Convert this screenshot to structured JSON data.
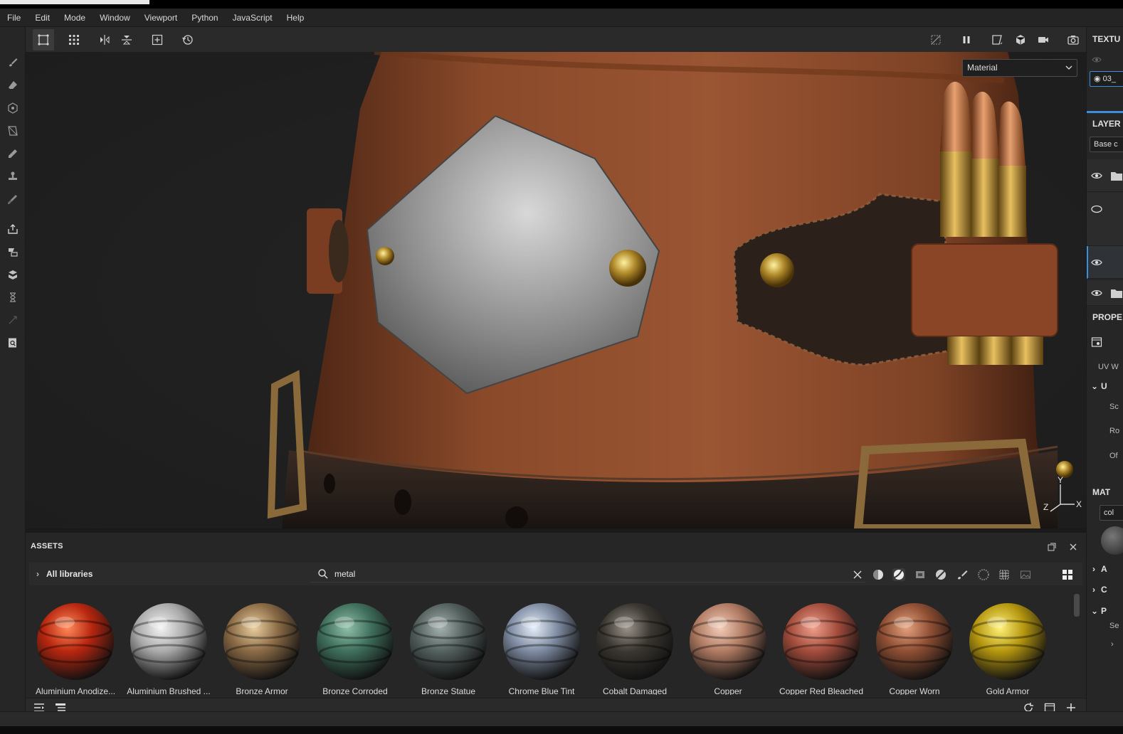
{
  "menubar": {
    "items": [
      "File",
      "Edit",
      "Mode",
      "Window",
      "Viewport",
      "Python",
      "JavaScript",
      "Help"
    ]
  },
  "viewport": {
    "display_mode": "Material",
    "axis_labels": {
      "y": "Y",
      "x": "X",
      "z": "Z"
    }
  },
  "right_panel": {
    "texture_set_header": "TEXTU",
    "texture_set_item": "03_",
    "layers_header": "LAYER",
    "layers_channel": "Base c",
    "properties_header": "PROPE",
    "uv_label": "UV W",
    "uv_section": "U",
    "scale_label": "Sc",
    "rotation_label": "Ro",
    "offset_label": "Of",
    "material_header": "MAT",
    "material_field": "col",
    "section_a": "A",
    "section_c": "C",
    "section_p": "P",
    "se_label": "Se"
  },
  "assets": {
    "title": "ASSETS",
    "libraries": "All libraries",
    "search_value": "metal",
    "materials": [
      {
        "name": "Aluminium Anodize...",
        "color": "#b8260f",
        "hi": "#ff8a5a"
      },
      {
        "name": "Aluminium Brushed ...",
        "color": "#a9a9a9",
        "hi": "#f4f4f4"
      },
      {
        "name": "Bronze Armor",
        "color": "#8a6a45",
        "hi": "#e9cfa0"
      },
      {
        "name": "Bronze Corroded",
        "color": "#3f6f5c",
        "hi": "#8fc0a8"
      },
      {
        "name": "Bronze Statue",
        "color": "#53605e",
        "hi": "#a4b2b0"
      },
      {
        "name": "Chrome Blue Tint",
        "color": "#7d8aa0",
        "hi": "#e6eefa"
      },
      {
        "name": "Cobalt Damaged",
        "color": "#3a3630",
        "hi": "#9a938a"
      },
      {
        "name": "Copper",
        "color": "#b07a62",
        "hi": "#f3cdb8"
      },
      {
        "name": "Copper Red Bleached",
        "color": "#a24c3c",
        "hi": "#f0a08c"
      },
      {
        "name": "Copper Worn",
        "color": "#8e4e33",
        "hi": "#e5a17e"
      },
      {
        "name": "Gold Armor",
        "color": "#b5960f",
        "hi": "#fff27a"
      }
    ]
  }
}
